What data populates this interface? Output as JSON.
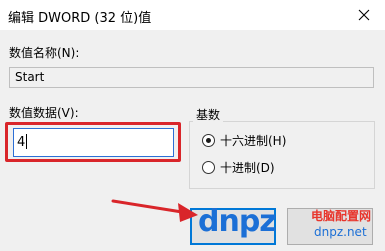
{
  "window": {
    "title": "编辑 DWORD (32 位)值",
    "close_icon": "close-icon"
  },
  "value_name": {
    "label": "数值名称(N):",
    "value": "Start"
  },
  "value_data": {
    "label": "数值数据(V):",
    "value": "4"
  },
  "base": {
    "label": "基数",
    "options": [
      {
        "label": "十六进制(H)",
        "selected": true
      },
      {
        "label": "十进制(D)",
        "selected": false
      }
    ]
  },
  "annotation": {
    "highlight_color": "#d9252a",
    "arrow_color": "#d9252a"
  },
  "watermark": {
    "logo": "dnpz",
    "site": "电脑配置网",
    "url": "dnpz.net"
  },
  "colors": {
    "dialog_bg": "#f0f0f0",
    "focus_blue": "#0078d7",
    "brand_blue": "#1b6fd6"
  }
}
